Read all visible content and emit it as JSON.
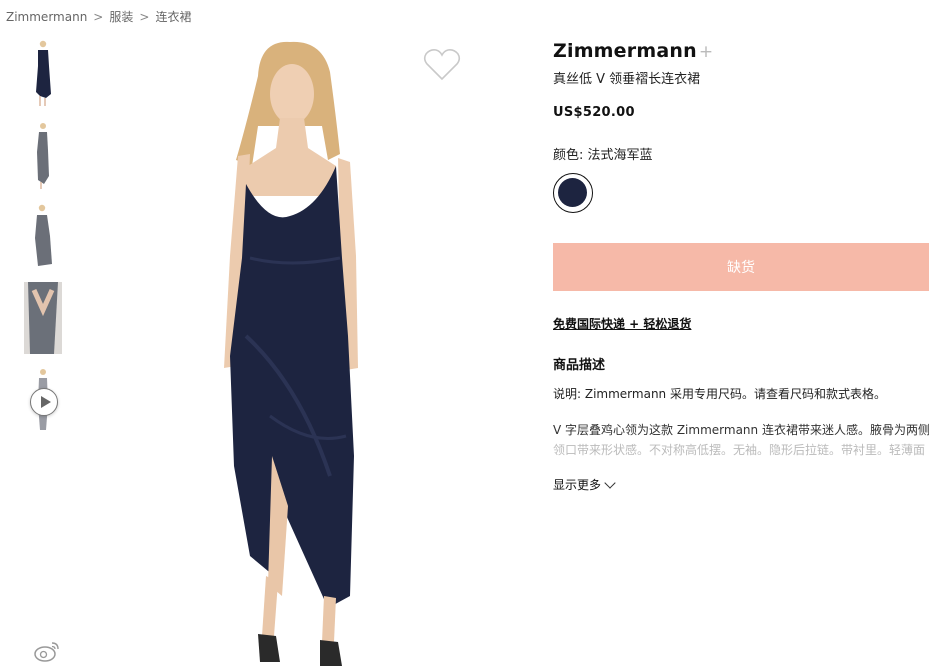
{
  "breadcrumb": {
    "items": [
      "Zimmermann",
      "服装",
      "连衣裙"
    ],
    "separator": ">"
  },
  "product": {
    "brand": "Zimmermann",
    "brand_suffix": "+",
    "title": "真丝低 V 领垂褶长连衣裙",
    "price": "US$520.00",
    "color_label": "颜色: 法式海军蓝",
    "swatch_color": "#1d2440",
    "soldout_label": "缺货",
    "soldout_color": "#f6b9a8",
    "shipping_link": "免费国际快递 + 轻松退货",
    "description_heading": "商品描述",
    "description_note": "说明: Zimmermann 采用专用尺码。请查看尺码和款式表格。",
    "description_line1": "V 字层叠鸡心领为这款 Zimmermann 连衣裙带来迷人感。腋骨为两侧和",
    "description_line2": "领口带来形状感。不对称高低摆。无袖。隐形后拉链。带衬里。轻薄面",
    "show_more": "显示更多"
  },
  "icons": {
    "heart": "heart-icon",
    "play": "play-icon",
    "weibo": "weibo-icon",
    "chevron": "chevron-down-icon"
  }
}
